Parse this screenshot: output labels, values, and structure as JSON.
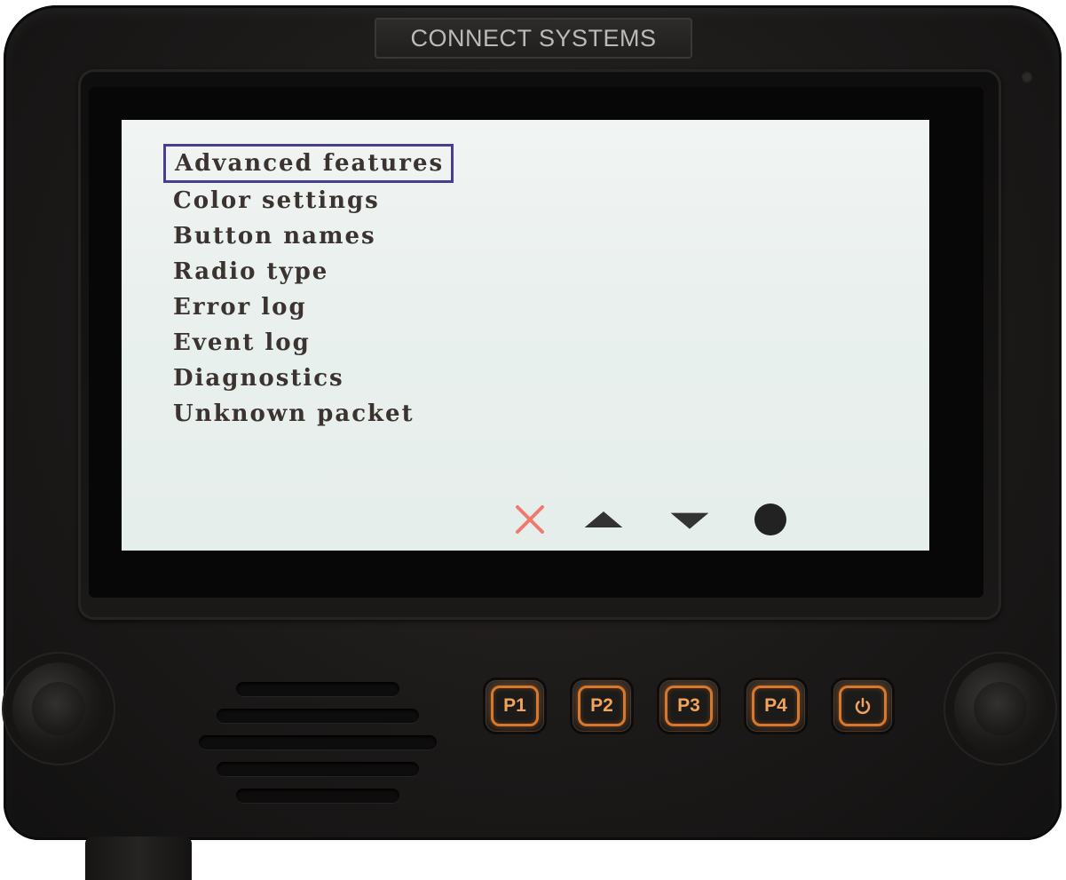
{
  "device": {
    "brand": "CONNECT SYSTEMS"
  },
  "menu": {
    "items": [
      {
        "label": "Advanced features",
        "selected": true
      },
      {
        "label": "Color settings",
        "selected": false
      },
      {
        "label": "Button names",
        "selected": false
      },
      {
        "label": "Radio type",
        "selected": false
      },
      {
        "label": "Error log",
        "selected": false
      },
      {
        "label": "Event log",
        "selected": false
      },
      {
        "label": "Diagnostics",
        "selected": false
      },
      {
        "label": "Unknown packet",
        "selected": false
      }
    ],
    "selection_color": "#4a3f8f",
    "text_color": "#3a332f"
  },
  "softkeys": [
    {
      "icon": "close-icon",
      "color": "#f07a6e"
    },
    {
      "icon": "up-arrow-icon",
      "color": "#333333"
    },
    {
      "icon": "down-arrow-icon",
      "color": "#333333"
    },
    {
      "icon": "select-dot-icon",
      "color": "#222222"
    }
  ],
  "hardware_buttons": [
    {
      "label": "P1"
    },
    {
      "label": "P2"
    },
    {
      "label": "P3"
    },
    {
      "label": "P4"
    },
    {
      "icon": "power-icon"
    }
  ],
  "colors": {
    "screen_background": "#eaf0ee",
    "button_accent": "#d9782a"
  }
}
